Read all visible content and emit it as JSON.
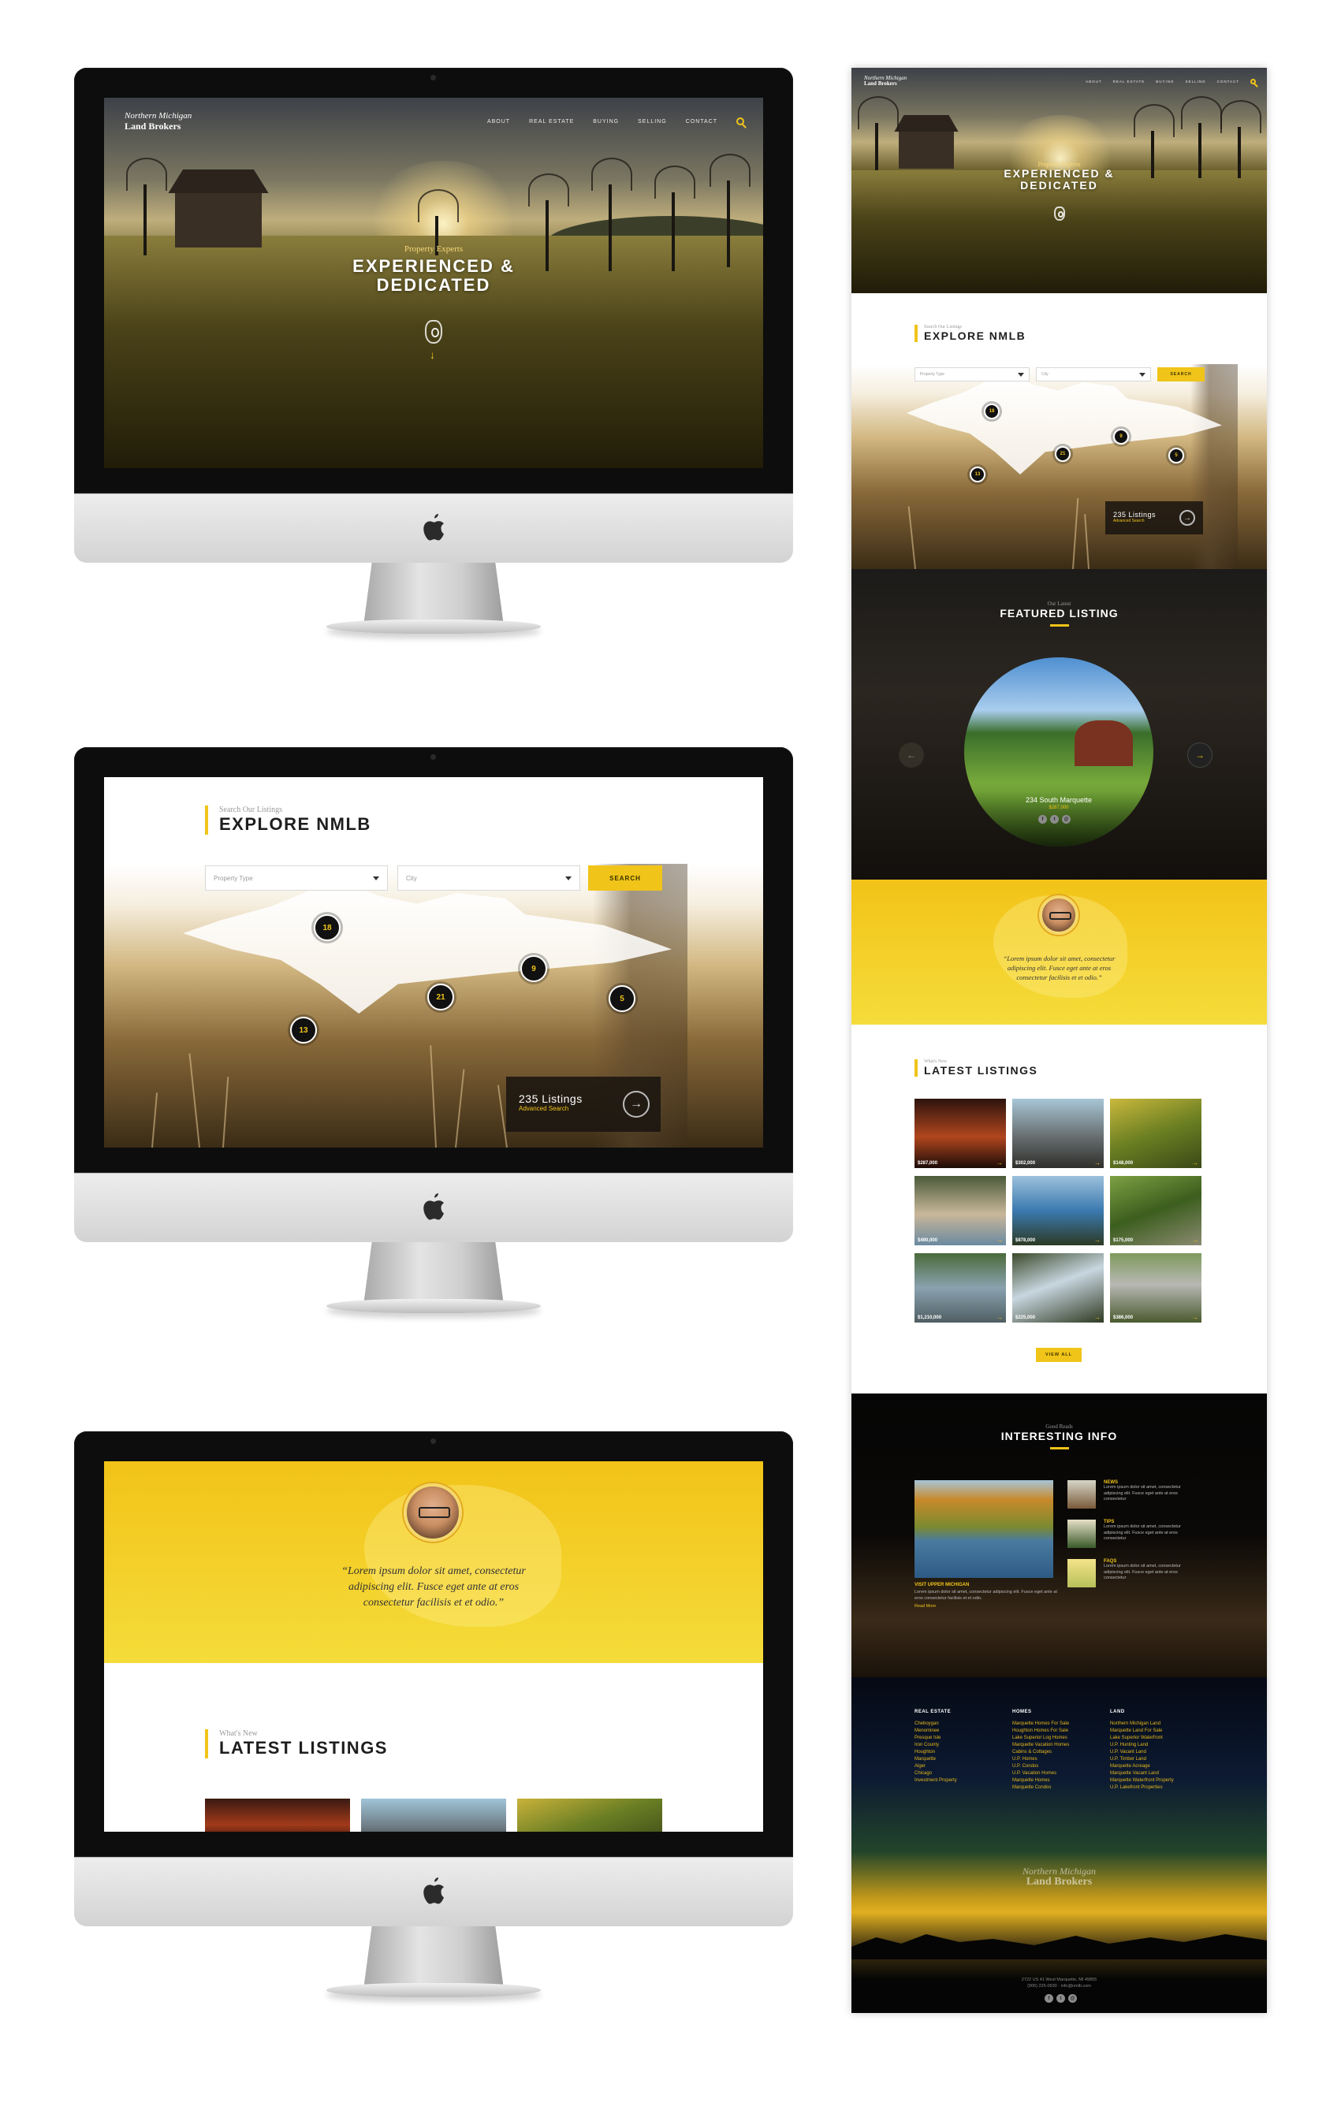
{
  "site": {
    "logo_line1": "Northern Michigan",
    "logo_line2": "Land Brokers",
    "nav": [
      "ABOUT",
      "REAL ESTATE",
      "BUYING",
      "SELLING",
      "CONTACT"
    ]
  },
  "hero": {
    "kicker": "Property Experts",
    "title_line1": "EXPERIENCED &",
    "title_line2": "DEDICATED"
  },
  "explore": {
    "sub": "Search Our Listings",
    "title": "EXPLORE NMLB",
    "property_type_placeholder": "Property Type",
    "city_placeholder": "City",
    "search_label": "SEARCH",
    "markers": [
      "18",
      "9",
      "21",
      "5",
      "13"
    ],
    "listings_count": "235 Listings",
    "advanced_search": "Advanced Search"
  },
  "featured": {
    "sub": "Our Latest",
    "title": "FEATURED LISTING",
    "name": "234 South Marquette",
    "price": "$287,000"
  },
  "testimonial": {
    "quote_line1": "“Lorem ipsum dolor sit amet, consectetur",
    "quote_line2": "adipiscing elit. Fusce eget ante at eros",
    "quote_line3": "consectetur facilisis et et odio.”"
  },
  "latest": {
    "sub": "What's New",
    "title": "LATEST LISTINGS",
    "prices": [
      "$287,000",
      "$302,000",
      "$148,000",
      "$490,000",
      "$878,000",
      "$175,000",
      "$1,210,000",
      "$225,000",
      "$386,000"
    ],
    "view_all": "VIEW ALL"
  },
  "info": {
    "sub": "Good Reads",
    "title": "INTERESTING INFO",
    "main_caption": "VISIT UPPER MICHIGAN",
    "main_text": "Lorem ipsum dolor sit amet, consectetur adipiscing elit. Fusce eget ante at eros consectetur facilisis et et odio.",
    "read_more": "Read More",
    "items": [
      {
        "title": "NEWS",
        "text": "Lorem ipsum dolor sit amet, consectetur adipiscing elit. Fusce eget ante at eros consectetur"
      },
      {
        "title": "TIPS",
        "text": "Lorem ipsum dolor sit amet, consectetur adipiscing elit. Fusce eget ante at eros consectetur"
      },
      {
        "title": "FAQS",
        "text": "Lorem ipsum dolor sit amet, consectetur adipiscing elit. Fusce eget ante at eros consectetur"
      }
    ]
  },
  "footer": {
    "col1_title": "REAL ESTATE",
    "col1": [
      "Cheboygan",
      "Menominee",
      "Presque Isle",
      "Iron County",
      "Houghton",
      "Marquette",
      "Alger",
      "Chicago",
      "Investment Property"
    ],
    "col2_title": "HOMES",
    "col2": [
      "Marquette Homes For Sale",
      "Houghton Homes For Sale",
      "Lake Superior Log Homes",
      "Marquette Vacation Homes",
      "Cabins & Cottages",
      "U.P. Homes",
      "U.P. Condos",
      "U.P. Vacation Homes",
      "Marquette Homes",
      "Marquette Condos"
    ],
    "col3_title": "LAND",
    "col3": [
      "Northern Michigan Land",
      "Marquette Land For Sale",
      "Lake Superior Waterfront",
      "U.P. Hunting Land",
      "U.P. Vacant Land",
      "U.P. Timber Land",
      "Marquette Acreage",
      "Marquette Vacant Land",
      "Marquette Waterfront Property",
      "U.P. Lakefront Properties"
    ],
    "address": "2722 US 41 West Marquette, MI 49855",
    "phone": "(906) 225-0930 · info@nmlb.com"
  },
  "colors": {
    "accent": "#f0c419",
    "dark": "#121212"
  }
}
